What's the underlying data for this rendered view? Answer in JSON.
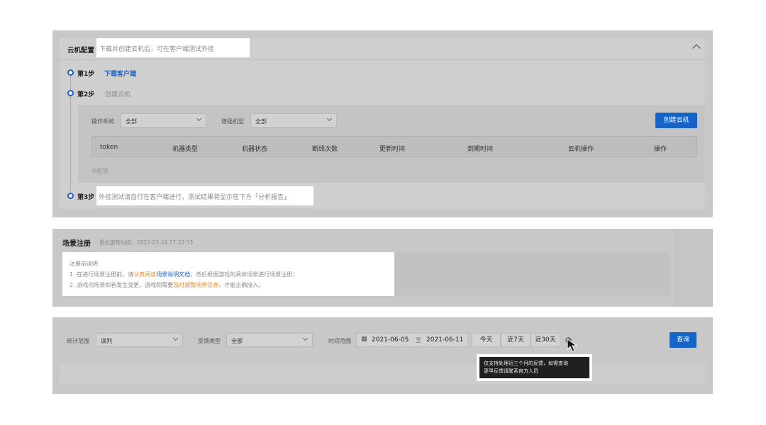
{
  "cloud_config": {
    "title": "云机配置",
    "subtitle": "下载并创建云机后，可在客户端测试外挂",
    "step1": {
      "label": "第1步",
      "link": "下载客户端"
    },
    "step2": {
      "label": "第2步",
      "text": "创建云机"
    },
    "filters": {
      "os_label": "操作系统",
      "os_value": "全部",
      "enh_label": "增强机型",
      "enh_value": "全部",
      "create_button": "创建云机"
    },
    "table_headers": [
      "token",
      "机器类型",
      "机器状态",
      "断线次数",
      "更新时间",
      "到期时间",
      "云机操作",
      "操作"
    ],
    "empty_status": "待配置",
    "step3": {
      "label": "第3步",
      "text": "外挂测试请自行在客户端进行，测试结果将显示在下方「分析报告」"
    }
  },
  "scene_register": {
    "title": "场景注册",
    "last_update": "最近更新时间：2022-03-24 17:22:33",
    "notice_title": "注册前说明",
    "line1_prefix": "1. 在进行场景注册前，请",
    "line1_orange": "认真阅读",
    "line1_blue": "场景说明文档",
    "line1_suffix": "，然后根据游戏的具体场景进行场景注册；",
    "line2_prefix": "2. 游戏内场景如若发生变更，游戏侧需要",
    "line2_orange": "及时调整场景信息",
    "line2_suffix": "，才能正确接入。"
  },
  "stats": {
    "range_label": "统计范围",
    "range_value": "误判",
    "type_label": "反馈类型",
    "type_value": "全部",
    "time_label": "时间范围",
    "date_start": "2021-06-05",
    "date_sep": "至",
    "date_end": "2021-06-11",
    "quick": [
      "今天",
      "近7天",
      "近30天"
    ],
    "query_button": "查询",
    "tooltip_line1": "仅支持处理近三个月的反馈，如需查询",
    "tooltip_line2": "更早反馈请联系官方人员"
  },
  "colors": {
    "primary": "#1464c8",
    "orange": "#ef8a1c"
  }
}
